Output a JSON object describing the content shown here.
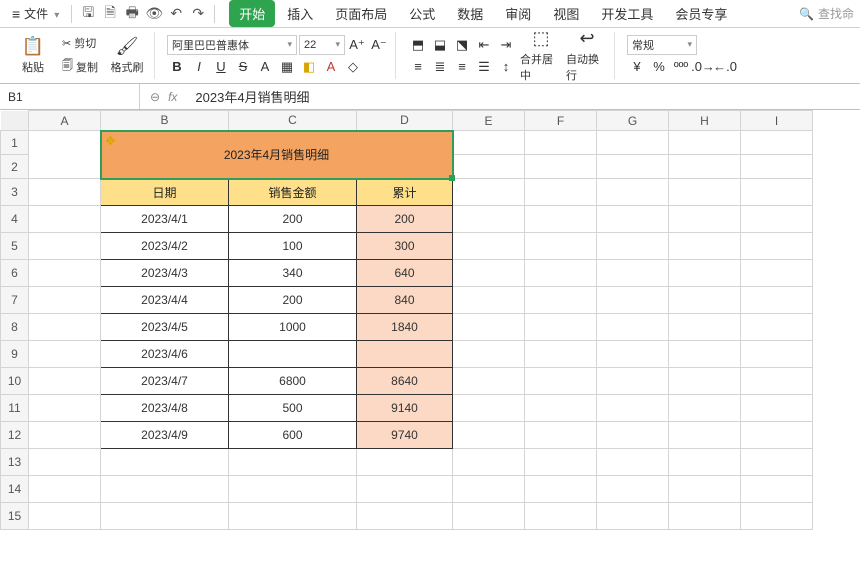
{
  "menubar": {
    "file_label": "文件",
    "tabs": [
      "开始",
      "插入",
      "页面布局",
      "公式",
      "数据",
      "审阅",
      "视图",
      "开发工具",
      "会员专享"
    ],
    "active_tab_index": 0,
    "search_placeholder": "查找命"
  },
  "ribbon": {
    "paste": "粘贴",
    "cut": "剪切",
    "copy": "复制",
    "format_painter": "格式刷",
    "font_name": "阿里巴巴普惠体",
    "font_size": "22",
    "merge_center": "合并居中",
    "wrap_text": "自动换行",
    "number_format": "常规"
  },
  "formula": {
    "namebox": "B1",
    "value": "2023年4月销售明细"
  },
  "columns": [
    "A",
    "B",
    "C",
    "D",
    "E",
    "F",
    "G",
    "H",
    "I"
  ],
  "row_labels": [
    "1",
    "2",
    "3",
    "4",
    "5",
    "6",
    "7",
    "8",
    "9",
    "10",
    "11",
    "12",
    "13",
    "14",
    "15"
  ],
  "title_text": "2023年4月销售明细",
  "title_hint": "✥",
  "headers": {
    "date": "日期",
    "amount": "销售金额",
    "accum": "累计"
  },
  "rows": [
    {
      "date": "2023/4/1",
      "amount": "200",
      "accum": "200"
    },
    {
      "date": "2023/4/2",
      "amount": "100",
      "accum": "300"
    },
    {
      "date": "2023/4/3",
      "amount": "340",
      "accum": "640"
    },
    {
      "date": "2023/4/4",
      "amount": "200",
      "accum": "840"
    },
    {
      "date": "2023/4/5",
      "amount": "1000",
      "accum": "1840"
    },
    {
      "date": "2023/4/6",
      "amount": "",
      "accum": ""
    },
    {
      "date": "2023/4/7",
      "amount": "6800",
      "accum": "8640"
    },
    {
      "date": "2023/4/8",
      "amount": "500",
      "accum": "9140"
    },
    {
      "date": "2023/4/9",
      "amount": "600",
      "accum": "9740"
    }
  ]
}
